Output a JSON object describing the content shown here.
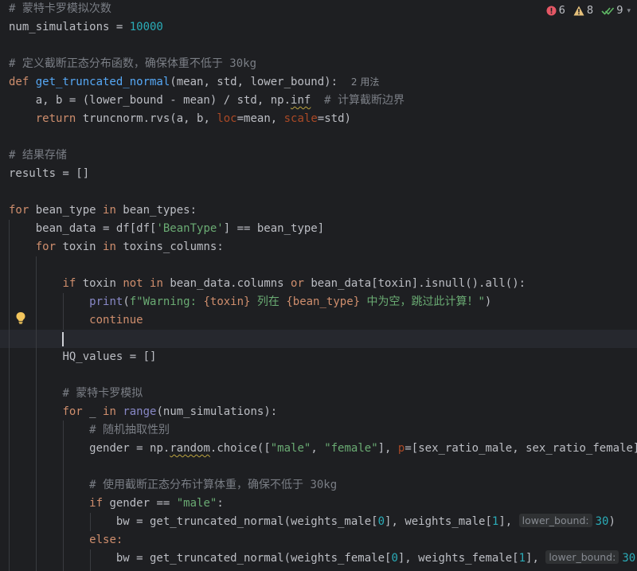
{
  "inspections": {
    "errors": "6",
    "warnings": "8",
    "typos": "9"
  },
  "colors": {
    "background": "#1e1f22",
    "keyword": "#cf8e6d",
    "function": "#56a8f5",
    "string": "#6aab73",
    "number": "#2aacb8",
    "comment": "#7a7e85",
    "error": "#e55765",
    "warning": "#e5c07b",
    "typo": "#5fb865"
  },
  "code": {
    "l1": "# 蒙特卡罗模拟次数",
    "l2_var": "num_simulations = ",
    "l2_num": "10000",
    "l4": "# 定义截断正态分布函数，确保体重不低于 30kg",
    "l5_def": "def ",
    "l5_name": "get_truncated_normal",
    "l5_args": "(mean, std, lower_bound):",
    "l5_usages": "2 用法",
    "l6_a": "    a, b = (lower_bound - mean) / std, np.",
    "l6_inf": "inf",
    "l6_cmt": "  # 计算截断边界",
    "l7_ret": "return",
    "l7_a": " truncnorm.rvs(a, b, ",
    "l7_loc": "loc",
    "l7_b": "=mean, ",
    "l7_scale": "scale",
    "l7_c": "=std)",
    "l9": "# 结果存储",
    "l10": "results = []",
    "l12_for": "for",
    "l12_a": " bean_type ",
    "l12_in": "in",
    "l12_b": " bean_types:",
    "l13_a": "    bean_data = df[df[",
    "l13_str": "'BeanType'",
    "l13_b": "] == bean_type]",
    "l14_for": "for",
    "l14_a": " toxin ",
    "l14_in": "in",
    "l14_b": " toxins_columns:",
    "l16_if": "if",
    "l16_a": " toxin ",
    "l16_not": "not in",
    "l16_b": " bean_data.columns ",
    "l16_or": "or",
    "l16_c": " bean_data[toxin].isnull().all():",
    "l17_print": "print",
    "l17_a": "(",
    "l17_s1": "f\"Warning: ",
    "l17_v1": "{toxin}",
    "l17_s2": " 列在 ",
    "l17_v2": "{bean_type}",
    "l17_s3": " 中为空，跳过此计算！\"",
    "l17_b": ")",
    "l18": "continue",
    "l20": "HQ_values = []",
    "l22": "# 蒙特卡罗模拟",
    "l23_for": "for",
    "l23_a": " _ ",
    "l23_in": "in",
    "l23_range": " range",
    "l23_b": "(num_simulations):",
    "l24": "# 随机抽取性别",
    "l25_a": "gender = np.",
    "l25_random": "random",
    "l25_b": ".choice([",
    "l25_s1": "\"male\"",
    "l25_c": ", ",
    "l25_s2": "\"female\"",
    "l25_d": "], ",
    "l25_p": "p",
    "l25_e": "=[sex_ratio_male, sex_ratio_female])",
    "l27": "# 使用截断正态分布计算体重，确保不低于 30kg",
    "l28_if": "if",
    "l28_a": " gender == ",
    "l28_s": "\"male\"",
    "l28_b": ":",
    "l29_a": "bw = get_truncated_normal(weights_male[",
    "l29_n0": "0",
    "l29_b": "], weights_male[",
    "l29_n1": "1",
    "l29_c": "], ",
    "l29_hint": "lower_bound:",
    "l29_n30": "30",
    "l29_d": ")",
    "l30": "else:",
    "l31_a": "bw = get_truncated_normal(weights_female[",
    "l31_n0": "0",
    "l31_b": "], weights_female[",
    "l31_n1": "1",
    "l31_c": "], ",
    "l31_hint": "lower_bound:",
    "l31_n30": "30",
    "l31_d": ")"
  }
}
